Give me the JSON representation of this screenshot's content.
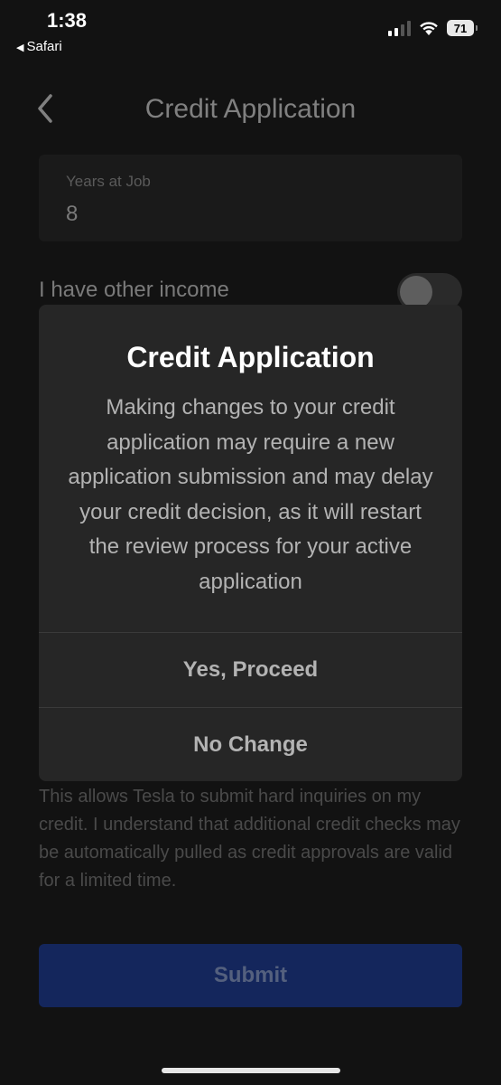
{
  "status_bar": {
    "time": "1:38",
    "back_app": "Safari",
    "battery": "71"
  },
  "header": {
    "title": "Credit Application"
  },
  "form": {
    "years_at_job_label": "Years at Job",
    "years_at_job_value": "8",
    "other_income_label": "I have other income",
    "other_income_toggle": false
  },
  "consent_text": "This allows Tesla to submit hard inquiries on my credit. I understand that additional credit checks may be automatically pulled as credit approvals are valid for a limited time.",
  "submit_label": "Submit",
  "modal": {
    "title": "Credit Application",
    "body": "Making changes to your credit application may require a new application submission and may delay your credit decision, as it will restart the review process for your active application",
    "proceed_label": "Yes, Proceed",
    "cancel_label": "No Change"
  },
  "colors": {
    "background": "#121212",
    "modal": "#262626",
    "submit": "#14265c"
  }
}
